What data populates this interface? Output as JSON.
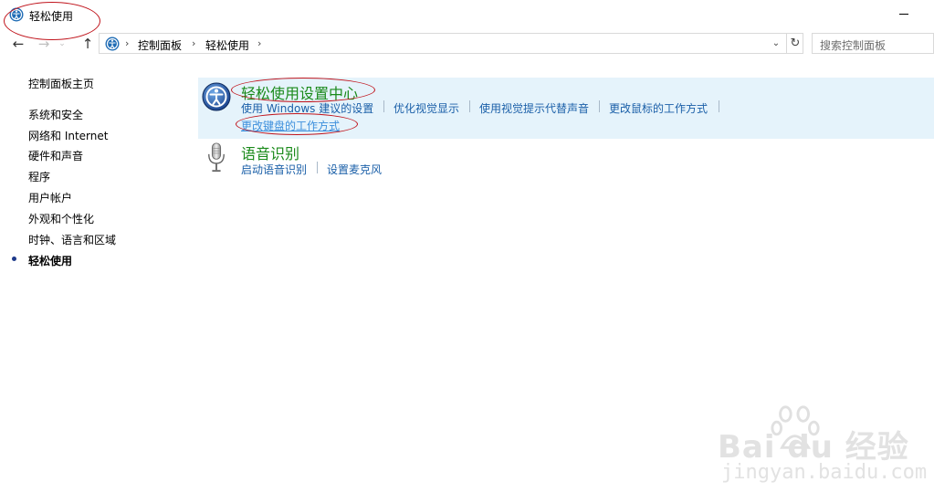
{
  "window": {
    "title": "轻松使用"
  },
  "toolbar": {
    "back_icon": "back-arrow-icon",
    "forward_icon": "forward-arrow-icon",
    "recent_icon": "chevron-down-icon",
    "up_icon": "up-arrow-icon",
    "breadcrumb": [
      "控制面板",
      "轻松使用"
    ],
    "refresh_icon": "refresh-icon",
    "search_placeholder": "搜索控制面板"
  },
  "sidebar": {
    "home": "控制面板主页",
    "items": [
      "系统和安全",
      "网络和 Internet",
      "硬件和声音",
      "程序",
      "用户帐户",
      "外观和个性化",
      "时钟、语言和区域",
      "轻松使用"
    ],
    "current": "轻松使用"
  },
  "main": {
    "categories": [
      {
        "title": "轻松使用设置中心",
        "icon": "ease-of-access-icon",
        "links": [
          "使用 Windows 建议的设置",
          "优化视觉显示",
          "使用视觉提示代替声音",
          "更改鼠标的工作方式",
          "更改键盘的工作方式"
        ]
      },
      {
        "title": "语音识别",
        "icon": "microphone-icon",
        "links": [
          "启动语音识别",
          "设置麦克风"
        ]
      }
    ]
  },
  "watermark": {
    "brand": "Bai du 经验",
    "url": "jingyan.baidu.com"
  },
  "colors": {
    "link": "#1a5fa8",
    "category_title": "#1a8a1a",
    "highlight_bg": "#e5f3fb",
    "annotation": "#c0141c"
  }
}
